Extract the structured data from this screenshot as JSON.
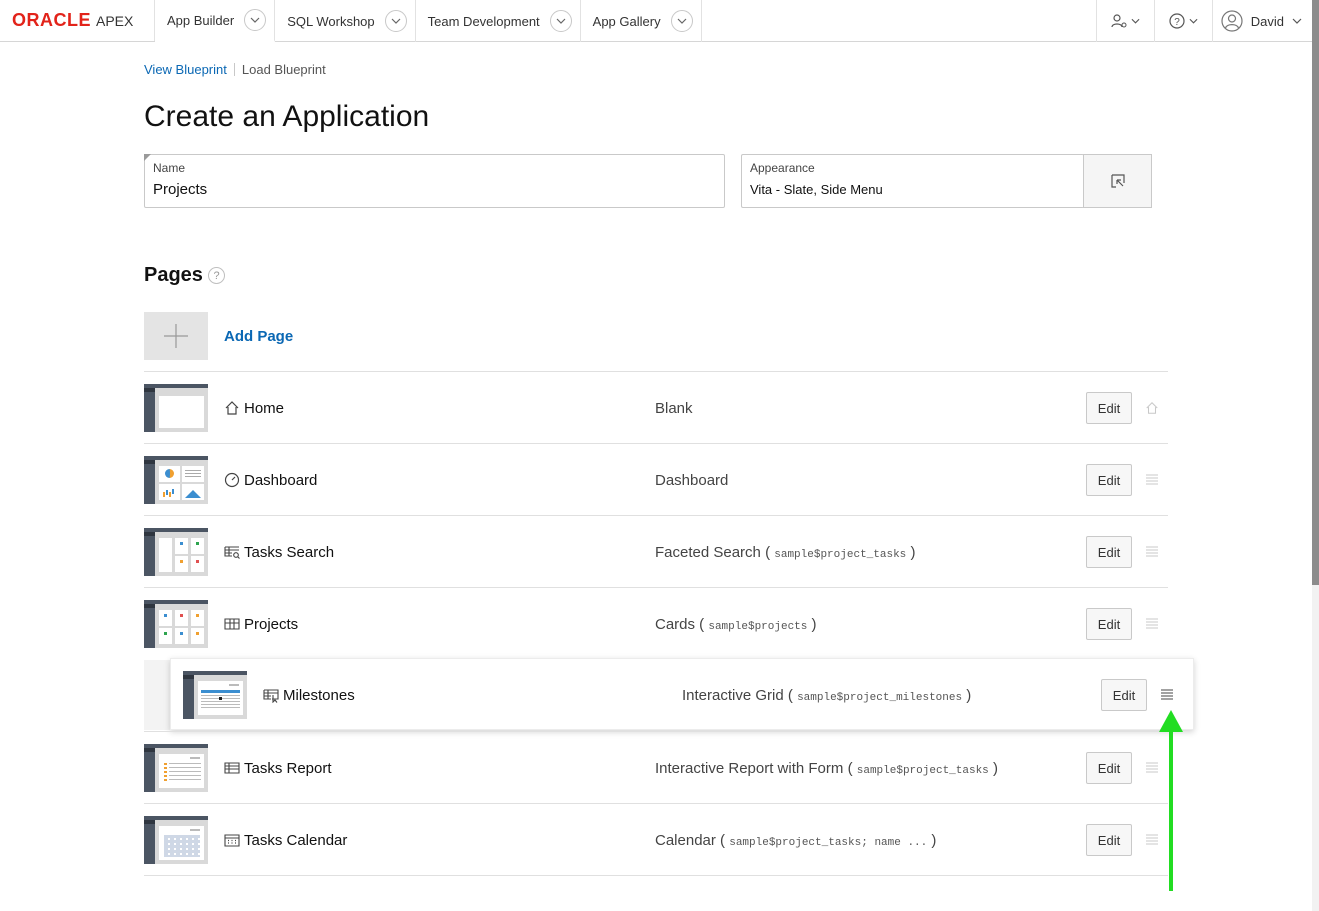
{
  "header": {
    "logo_brand": "ORACLE",
    "logo_product": "APEX",
    "tabs": [
      {
        "label": "App Builder"
      },
      {
        "label": "SQL Workshop"
      },
      {
        "label": "Team Development"
      },
      {
        "label": "App Gallery"
      }
    ],
    "user_name": "David"
  },
  "breadcrumb": {
    "view_blueprint": "View Blueprint",
    "load_blueprint": "Load Blueprint"
  },
  "page_title": "Create an Application",
  "form": {
    "name_label": "Name",
    "name_value": "Projects",
    "appearance_label": "Appearance",
    "appearance_value": "Vita - Slate, Side Menu"
  },
  "pages_section": {
    "heading": "Pages",
    "help": "?",
    "add_page_label": "Add Page",
    "edit_label": "Edit",
    "rows": [
      {
        "name": "Home",
        "type": "Blank",
        "source": "",
        "icon": "home-icon"
      },
      {
        "name": "Dashboard",
        "type": "Dashboard",
        "source": "",
        "icon": "gauge-icon"
      },
      {
        "name": "Tasks Search",
        "type": "Faceted Search",
        "source": "sample$project_tasks",
        "icon": "faceted-search-icon"
      },
      {
        "name": "Projects",
        "type": "Cards",
        "source": "sample$projects",
        "icon": "cards-icon"
      },
      {
        "name": "Milestones",
        "type": "Interactive Grid",
        "source": "sample$project_milestones",
        "icon": "interactive-grid-icon"
      },
      {
        "name": "Tasks Report",
        "type": "Interactive Report with Form",
        "source": "sample$project_tasks",
        "icon": "report-icon"
      },
      {
        "name": "Tasks Calendar",
        "type": "Calendar",
        "source": "sample$project_tasks; name ...",
        "icon": "calendar-icon"
      }
    ]
  },
  "colors": {
    "link": "#0b68b4",
    "oracle_red": "#e2231a",
    "annotation_arrow": "#22dd22"
  }
}
